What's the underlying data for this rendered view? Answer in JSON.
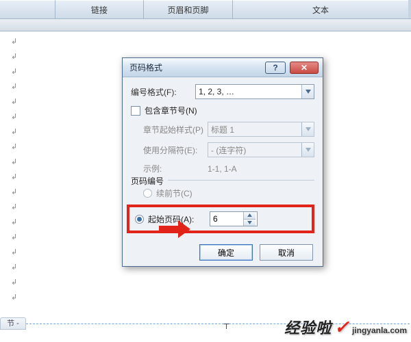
{
  "ribbon": {
    "link": "链接",
    "headerFooter": "页眉和页脚",
    "text": "文本"
  },
  "page": {
    "sectionTab": "节 -",
    "paraMark": "↲",
    "cursorMark": "⸆"
  },
  "dialog": {
    "title": "页码格式",
    "formatLabel": "编号格式(F):",
    "formatValue": "1, 2, 3, …",
    "includeChapter": "包含章节号(N)",
    "chapterStyleLabel": "章节起始样式(P)",
    "chapterStyleValue": "标题 1",
    "separatorLabel": "使用分隔符(E):",
    "separatorValue": "- (连字符)",
    "exampleLabel": "示例:",
    "exampleValue": "1-1, 1-A",
    "numberingTitle": "页码编号",
    "continue": "续前节(C)",
    "startAtLabel": "起始页码(A):",
    "startAtValue": "6",
    "ok": "确定",
    "cancel": "取消"
  },
  "watermark": {
    "main": "经验啦",
    "sub": "jingyanla.com",
    "check": "✓"
  }
}
